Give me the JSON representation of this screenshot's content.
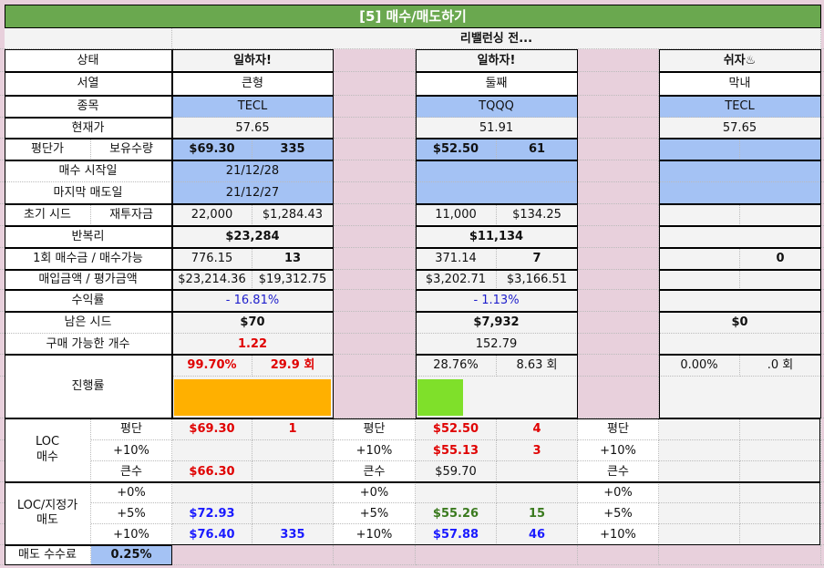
{
  "title": "[5] 매수/매도하기",
  "subtitle": "리밸런싱 전...",
  "labels": {
    "status": "상태",
    "rank": "서열",
    "ticker": "종목",
    "price": "현재가",
    "avg": "평단가",
    "qty": "보유수량",
    "buy_start": "매수 시작일",
    "last_sell": "마지막 매도일",
    "seed": "초기 시드",
    "reinvest": "재투자금",
    "compound": "반복리",
    "per_buy": "1회 매수금 / 매수가능",
    "buy_eval": "매입금액 / 평가금액",
    "return": "수익률",
    "remain_seed": "남은 시드",
    "buyable": "구매 가능한 개수",
    "progress": "진행률",
    "loc_buy": "LOC\n매수",
    "loc_sell": "LOC/지정가\n매도",
    "avg_short": "평단",
    "p10": "+10%",
    "big": "큰수",
    "p0": "+0%",
    "p5": "+5%",
    "fee": "매도 수수료",
    "fee_value": "0.25%"
  },
  "stocks": [
    {
      "status": "일하자!",
      "rank": "큰형",
      "ticker": "TECL",
      "price": "57.65",
      "avg": "$69.30",
      "qty": "335",
      "buy_start": "21/12/28",
      "last_sell": "21/12/27",
      "seed": "22,000",
      "reinvest": "$1,284.43",
      "compound": "$23,284",
      "per_buy": "776.15",
      "buyable_count": "13",
      "buy_amount": "$23,214.36",
      "eval_amount": "$19,312.75",
      "return": "- 16.81%",
      "remain_seed": "$70",
      "buyable": "1.22",
      "progress_pct": "99.70%",
      "progress_count": "29.9 회",
      "progress_fill": 0.997,
      "bar_color": "#ffb000",
      "loc_avg_price": "$69.30",
      "loc_avg_qty": "1",
      "loc_p10_price": "",
      "loc_p10_qty": "",
      "loc_big_price": "$66.30",
      "loc_big_qty": "",
      "sell_p0_price": "",
      "sell_p0_qty": "",
      "sell_p5_price": "$72.93",
      "sell_p5_qty": "",
      "sell_p10_price": "$76.40",
      "sell_p10_qty": "335"
    },
    {
      "status": "일하자!",
      "rank": "둘째",
      "ticker": "TQQQ",
      "price": "51.91",
      "avg": "$52.50",
      "qty": "61",
      "buy_start": "",
      "last_sell": "",
      "seed": "11,000",
      "reinvest": "$134.25",
      "compound": "$11,134",
      "per_buy": "371.14",
      "buyable_count": "7",
      "buy_amount": "$3,202.71",
      "eval_amount": "$3,166.51",
      "return": "- 1.13%",
      "remain_seed": "$7,932",
      "buyable": "152.79",
      "progress_pct": "28.76%",
      "progress_count": "8.63 회",
      "progress_fill": 0.2876,
      "bar_color": "#7fe02a",
      "loc_avg_price": "$52.50",
      "loc_avg_qty": "4",
      "loc_p10_price": "$55.13",
      "loc_p10_qty": "3",
      "loc_big_price": "$59.70",
      "loc_big_qty": "",
      "sell_p0_price": "",
      "sell_p0_qty": "",
      "sell_p5_price": "$55.26",
      "sell_p5_qty": "15",
      "sell_p10_price": "$57.88",
      "sell_p10_qty": "46"
    },
    {
      "status": "쉬자♨",
      "rank": "막내",
      "ticker": "TECL",
      "price": "57.65",
      "avg": "",
      "qty": "",
      "buy_start": "",
      "last_sell": "",
      "seed": "",
      "reinvest": "",
      "compound": "",
      "per_buy": "",
      "buyable_count": "0",
      "buy_amount": "",
      "eval_amount": "",
      "return": "",
      "remain_seed": "$0",
      "buyable": "",
      "progress_pct": "0.00%",
      "progress_count": ".0 회",
      "progress_fill": 0,
      "bar_color": "#ffffff",
      "loc_avg_price": "",
      "loc_avg_qty": "",
      "loc_p10_price": "",
      "loc_p10_qty": "",
      "loc_big_price": "",
      "loc_big_qty": "",
      "sell_p0_price": "",
      "sell_p0_qty": "",
      "sell_p5_price": "",
      "sell_p5_qty": "",
      "sell_p10_price": "",
      "sell_p10_qty": ""
    }
  ]
}
